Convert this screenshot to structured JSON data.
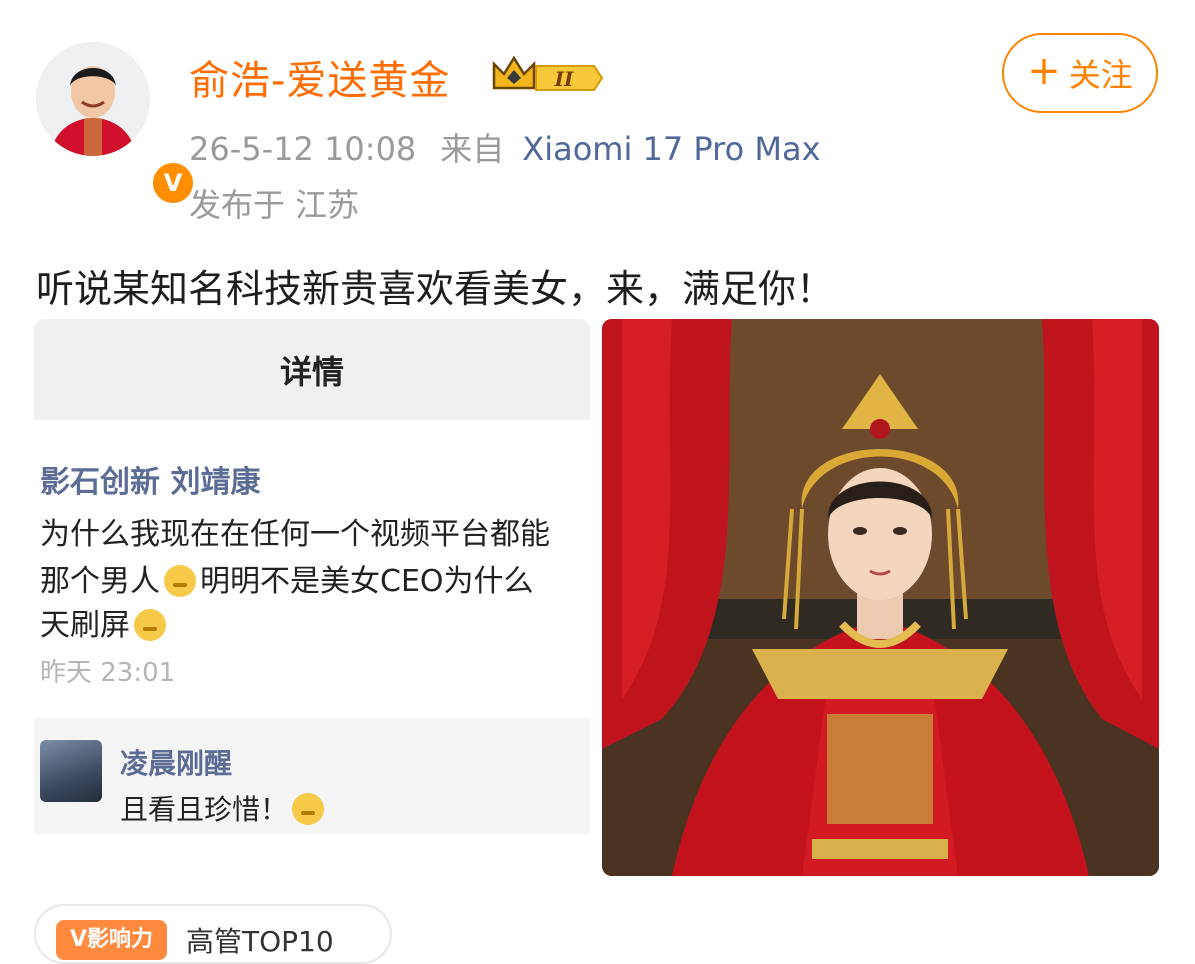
{
  "author": {
    "name": "俞浩-爱送黄金",
    "verified_badge": "V",
    "level_badge": "II"
  },
  "follow_button": {
    "label": "关注",
    "icon": "plus-icon"
  },
  "meta": {
    "time": "26-5-12 10:08",
    "from_label": "来自",
    "device": "Xiaomi 17 Pro Max",
    "location": "发布于 江苏"
  },
  "post": {
    "text": "听说某知名科技新贵喜欢看美女，来，满足你！"
  },
  "image1": {
    "header": "详情",
    "comment": {
      "author": "影石创新 刘靖康",
      "lines": [
        "为什么我现在在任何一个视频平台都能",
        "那个男人",
        "明明不是美女CEO为什么",
        "天刷屏"
      ],
      "time": "昨天 23:01"
    },
    "reply": {
      "author": "凌晨刚醒",
      "text": "且看且珍惜！"
    }
  },
  "bottom_tag": {
    "badge": "V影响力",
    "text": "高管TOP10"
  },
  "colors": {
    "accent": "#ff8200",
    "username": "#ff6d00",
    "link": "#50689a"
  }
}
